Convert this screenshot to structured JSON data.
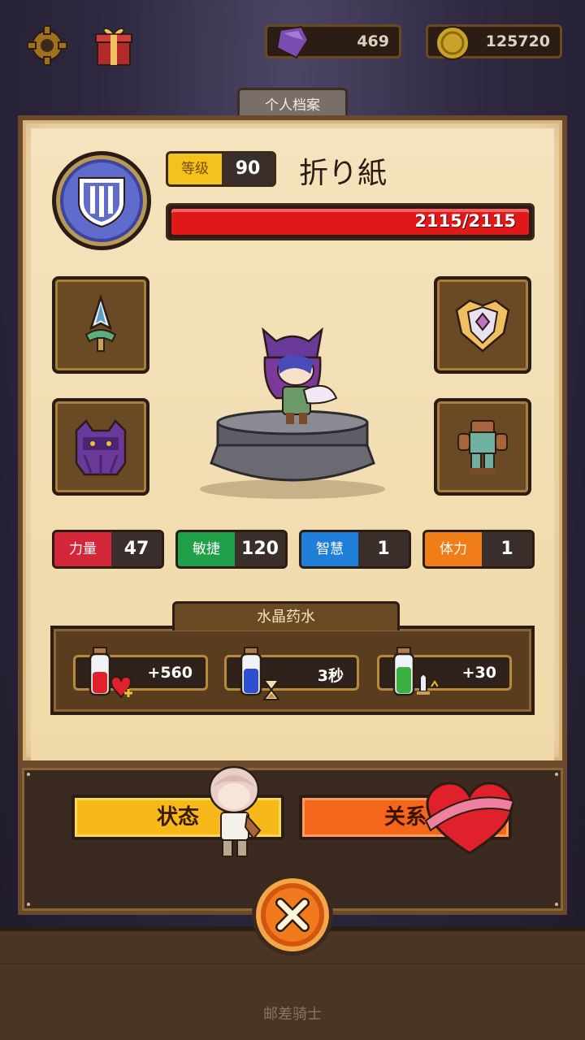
{
  "resources": {
    "gems": "469",
    "coins": "125720"
  },
  "panel_tab": "个人档案",
  "hero": {
    "level_label": "等级",
    "level": "90",
    "name": "折り紙",
    "hp_text": "2115/2115",
    "hp_fraction": 1.0
  },
  "equipment": {
    "weapon": "spear-icon",
    "helmet": "cat-hood-icon",
    "shield": "crest-shield-icon",
    "armor": "leather-armor-icon"
  },
  "stats": [
    {
      "label": "力量",
      "value": "47",
      "color": "#d4273a"
    },
    {
      "label": "敏捷",
      "value": "120",
      "color": "#21a04a"
    },
    {
      "label": "智慧",
      "value": "1",
      "color": "#1f7fd8"
    },
    {
      "label": "体力",
      "value": "1",
      "color": "#f07d18"
    }
  ],
  "potions": {
    "title": "水晶药水",
    "items": [
      {
        "value": "+560",
        "icon": "red-potion-heart-icon"
      },
      {
        "value": "3秒",
        "icon": "blue-potion-hourglass-icon"
      },
      {
        "value": "+30",
        "icon": "green-potion-sword-icon"
      }
    ]
  },
  "buttons": {
    "status": "状态",
    "relation": "关系"
  },
  "footer": "邮差骑士"
}
